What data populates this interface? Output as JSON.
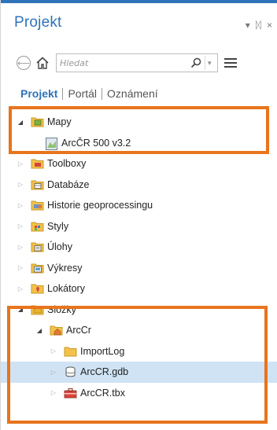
{
  "pane": {
    "title": "Projekt",
    "controls": {
      "dropdown": "▾",
      "pin": "ᛞ",
      "close": "×"
    }
  },
  "toolbar": {
    "back_icon": "⟵",
    "search_placeholder": "Hledat",
    "dropdown_caret": "▾"
  },
  "tabs": [
    {
      "label": "Projekt",
      "active": true
    },
    {
      "label": "Portál",
      "active": false
    },
    {
      "label": "Oznámení",
      "active": false
    }
  ],
  "tree": [
    {
      "label": "Mapy",
      "expanded": true,
      "icon": "map-folder-icon"
    },
    {
      "label": "ArcČR 500 v3.2",
      "icon": "map-icon"
    },
    {
      "label": "Toolboxy",
      "expanded": false,
      "icon": "toolbox-folder-icon"
    },
    {
      "label": "Databáze",
      "expanded": false,
      "icon": "database-folder-icon"
    },
    {
      "label": "Historie geoprocessingu",
      "expanded": false,
      "icon": "history-folder-icon"
    },
    {
      "label": "Styly",
      "expanded": false,
      "icon": "styles-folder-icon"
    },
    {
      "label": "Úlohy",
      "expanded": false,
      "icon": "tasks-folder-icon"
    },
    {
      "label": "Výkresy",
      "expanded": false,
      "icon": "layouts-folder-icon"
    },
    {
      "label": "Lokátory",
      "expanded": false,
      "icon": "locators-folder-icon"
    },
    {
      "label": "Složky",
      "expanded": true,
      "icon": "folders-icon"
    },
    {
      "label": "ArcCr",
      "expanded": true,
      "icon": "home-folder-icon"
    },
    {
      "label": "ImportLog",
      "expanded": false,
      "icon": "folder-icon"
    },
    {
      "label": "ArcCR.gdb",
      "expanded": false,
      "icon": "geodatabase-icon",
      "selected": true
    },
    {
      "label": "ArcCR.tbx",
      "expanded": false,
      "icon": "toolbox-icon"
    }
  ],
  "colors": {
    "accent": "#2f73b8",
    "highlight_box": "#e8741c",
    "selection": "#cfe3f4",
    "folder": "#f2c24a"
  }
}
